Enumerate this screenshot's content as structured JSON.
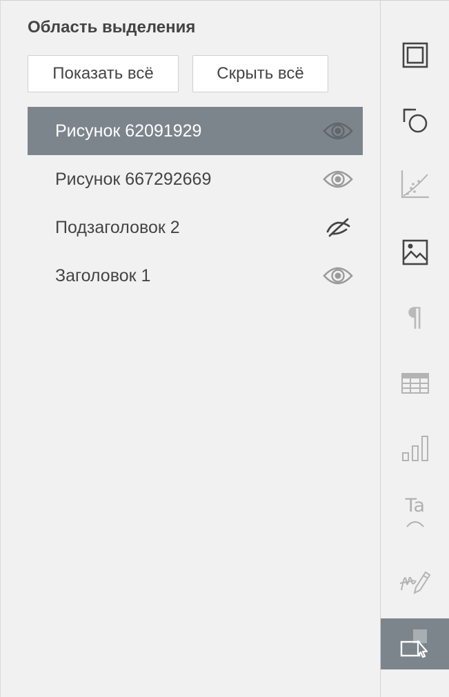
{
  "panel": {
    "title": "Область выделения",
    "show_all_label": "Показать всё",
    "hide_all_label": "Скрыть всё",
    "items": [
      {
        "label": "Рисунок 62091929",
        "visible": true,
        "selected": true
      },
      {
        "label": "Рисунок 667292669",
        "visible": true,
        "selected": false
      },
      {
        "label": "Подзаголовок 2",
        "visible": false,
        "selected": false
      },
      {
        "label": "Заголовок 1",
        "visible": true,
        "selected": false
      }
    ]
  },
  "right_toolbar": {
    "buttons": [
      {
        "icon": "slide-settings-icon",
        "enabled": true,
        "active": false
      },
      {
        "icon": "shape-settings-icon",
        "enabled": true,
        "active": false
      },
      {
        "icon": "chart-settings-icon",
        "enabled": false,
        "active": false
      },
      {
        "icon": "image-settings-icon",
        "enabled": true,
        "active": false
      },
      {
        "icon": "paragraph-settings-icon",
        "enabled": false,
        "active": false
      },
      {
        "icon": "table-settings-icon",
        "enabled": false,
        "active": false
      },
      {
        "icon": "chart-bar-settings-icon",
        "enabled": false,
        "active": false
      },
      {
        "icon": "text-art-settings-icon",
        "enabled": false,
        "active": false,
        "label": "Ta"
      },
      {
        "icon": "signature-settings-icon",
        "enabled": false,
        "active": false
      },
      {
        "icon": "selection-pane-icon",
        "enabled": true,
        "active": true
      }
    ]
  },
  "colors": {
    "background": "#f1f1f1",
    "selected_row": "#7d858c",
    "text": "#444444",
    "icon_enabled": "#444444",
    "icon_disabled": "#b3b3b3"
  }
}
